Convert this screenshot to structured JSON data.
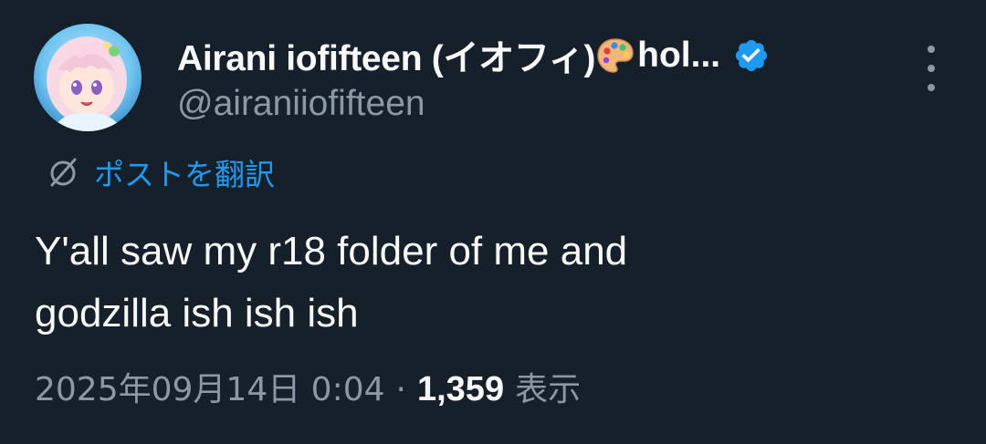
{
  "author": {
    "display_name": "Airani iofifteen (イオフィ)",
    "name_emoji_icon": "artist-palette-icon",
    "display_name_tail": "hol...",
    "handle": "@airaniiofifteen",
    "verified": true,
    "verified_color": "#1d9bf0",
    "avatar_icon": "profile-avatar-icon"
  },
  "menu": {
    "more_icon": "more-vertical-icon"
  },
  "translate": {
    "icon": "translate-globe-icon",
    "label": "ポストを翻訳"
  },
  "post": {
    "text_line1": "Y'all saw my r18 folder of me and",
    "text_line2": "godzilla ish ish ish"
  },
  "meta": {
    "timestamp": "2025年09月14日 0:04",
    "separator": "·",
    "views_count": "1,359",
    "views_label": "表示"
  },
  "colors": {
    "background": "#15202b",
    "primary_text": "#f7f9f9",
    "secondary_text": "#8b98a5",
    "accent": "#1d9bf0"
  }
}
